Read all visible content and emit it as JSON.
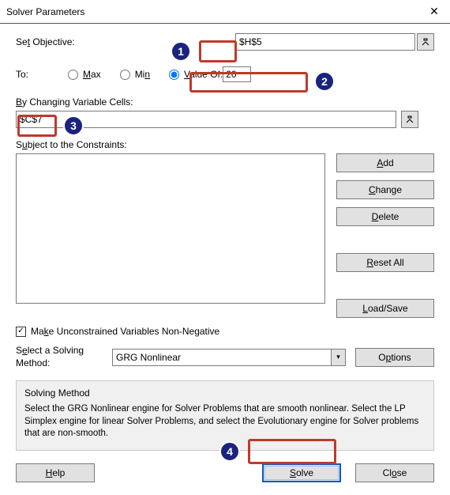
{
  "window": {
    "title": "Solver Parameters"
  },
  "labels": {
    "set_objective": "Set Objective:",
    "to": "To:",
    "max": "Max",
    "min": "Min",
    "value_of": "Value Of:",
    "changing_cells": "By Changing Variable Cells:",
    "subject": "Subject to the Constraints:",
    "unconstrained": "Make Unconstrained Variables Non-Negative",
    "select_method": "Select a Solving Method:",
    "solving_method_title": "Solving Method",
    "solving_method_desc": "Select the GRG Nonlinear engine for Solver Problems that are smooth nonlinear. Select the LP Simplex engine for linear Solver Problems, and select the Evolutionary engine for Solver problems that are non-smooth."
  },
  "values": {
    "objective": "$H$5",
    "value_of": "20",
    "changing_cells": "$C$7",
    "method": "GRG Nonlinear",
    "checkmark": "✓"
  },
  "buttons": {
    "add": "Add",
    "change": "Change",
    "delete": "Delete",
    "reset_all": "Reset All",
    "load_save": "Load/Save",
    "options": "Options",
    "help": "Help",
    "solve": "Solve",
    "close": "Close"
  },
  "callouts": {
    "n1": "1",
    "n2": "2",
    "n3": "3",
    "n4": "4"
  }
}
